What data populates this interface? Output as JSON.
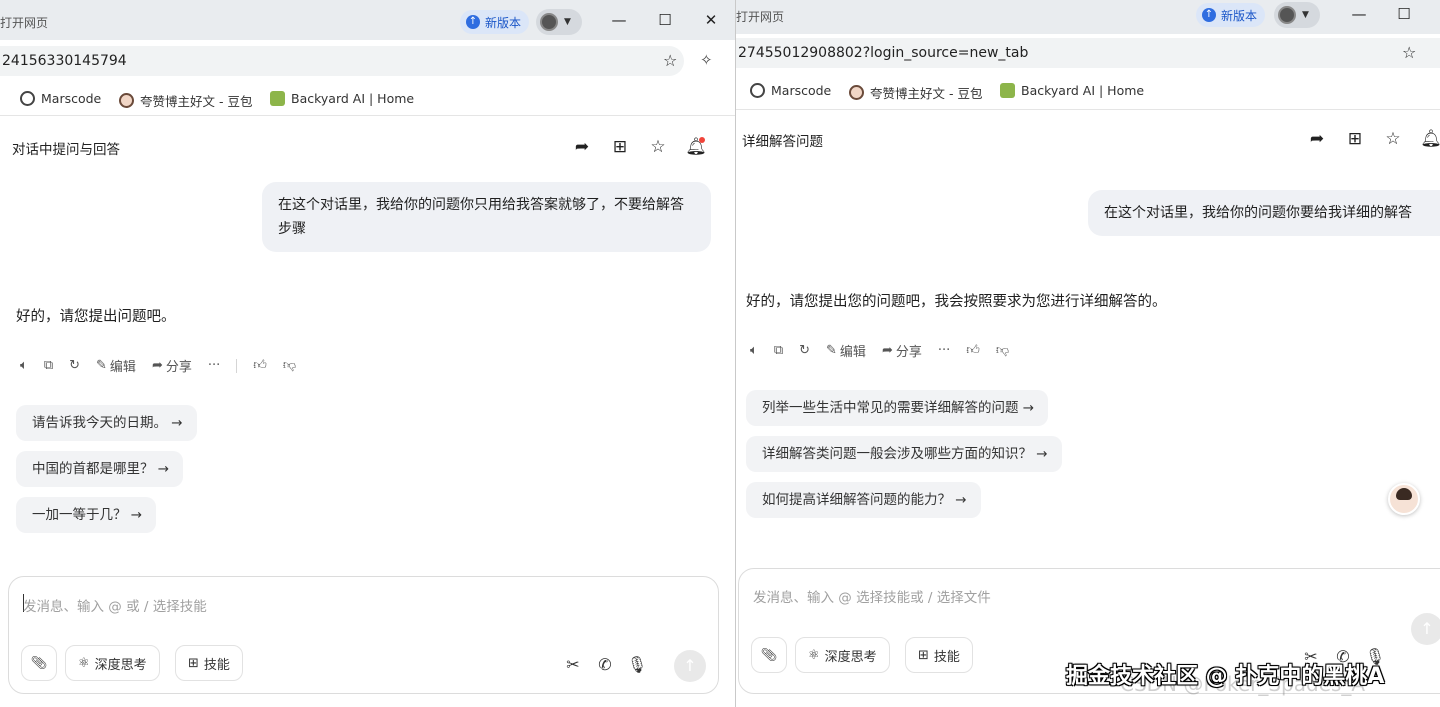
{
  "left": {
    "titlebar": {
      "title": "打开网页",
      "new_version": "新版本"
    },
    "address": "24156330145794",
    "bookmarks": [
      "Marscode",
      "夸赞博主好文 - 豆包",
      "Backyard AI | Home"
    ],
    "conversation_title": "对话中提问与回答",
    "user_message": "在这个对话里，我给你的问题你只用给我答案就够了，不要给解答步骤",
    "assistant_message": "好的，请您提出问题吧。",
    "actions": {
      "edit": "编辑",
      "share": "分享"
    },
    "suggestions": [
      "请告诉我今天的日期。 →",
      "中国的首都是哪里？ →",
      "一加一等于几？ →"
    ],
    "composer": {
      "placeholder": "发消息、输入 @ 或 / 选择技能",
      "deep_think": "深度思考",
      "skills": "技能"
    }
  },
  "right": {
    "titlebar": {
      "title": "打开网页",
      "new_version": "新版本"
    },
    "address": "27455012908802?login_source=new_tab",
    "bookmarks": [
      "Marscode",
      "夸赞博主好文 - 豆包",
      "Backyard AI | Home"
    ],
    "conversation_title": "详细解答问题",
    "user_message": "在这个对话里，我给你的问题你要给我详细的解答",
    "assistant_message": "好的，请您提出您的问题吧，我会按照要求为您进行详细解答的。",
    "actions": {
      "edit": "编辑",
      "share": "分享"
    },
    "suggestions": [
      "列举一些生活中常见的需要详细解答的问题 →",
      "详细解答类问题一般会涉及哪些方面的知识？ →",
      "如何提高详细解答问题的能力？ →"
    ],
    "composer": {
      "placeholder": "发消息、输入 @ 选择技能或 / 选择文件",
      "deep_think": "深度思考",
      "skills": "技能"
    }
  },
  "watermark": "掘金技术社区 @ 扑克中的黑桃A",
  "watermark_faint": "CSDN @Poker_Spades_A"
}
